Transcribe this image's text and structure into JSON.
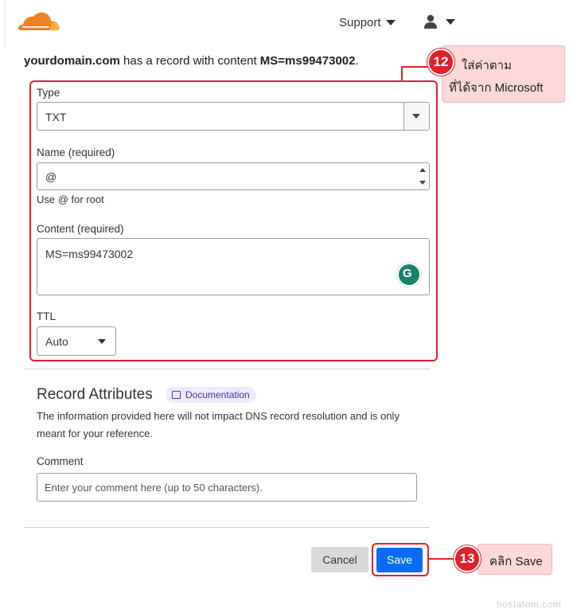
{
  "header": {
    "support_label": "Support",
    "icons": {
      "logo": "cloudflare-logo",
      "user": "user-icon",
      "caret": "caret-down-icon"
    }
  },
  "intro": {
    "domain": "yourdomain.com",
    "middle": " has a record with content ",
    "content": "MS=ms99473002",
    "end": "."
  },
  "form": {
    "type_label": "Type",
    "type_value": "TXT",
    "name_label": "Name (required)",
    "name_value": "@",
    "name_helper": "Use @ for root",
    "content_label": "Content (required)",
    "content_value": "MS=ms99473002",
    "ttl_label": "TTL",
    "ttl_value": "Auto"
  },
  "record_attributes": {
    "title": "Record Attributes",
    "doc_badge": "Documentation",
    "description": "The information provided here will not impact DNS record resolution and is only meant for your reference.",
    "comment_label": "Comment",
    "comment_placeholder": "Enter your comment here (up to 50 characters)."
  },
  "actions": {
    "cancel_label": "Cancel",
    "save_label": "Save"
  },
  "annotations": {
    "step12_number": "12",
    "step12_line1": "ใส่ค่าตาม",
    "step12_line2": "ที่ได้จาก Microsoft",
    "step13_number": "13",
    "step13_text": "คลิก Save",
    "highlight_color": "#e0202a",
    "callout_bg": "#fcd8d9"
  },
  "colors": {
    "save_button": "#0a6cf5",
    "brand_orange": "#f38020"
  },
  "watermark": "hostatom.com"
}
